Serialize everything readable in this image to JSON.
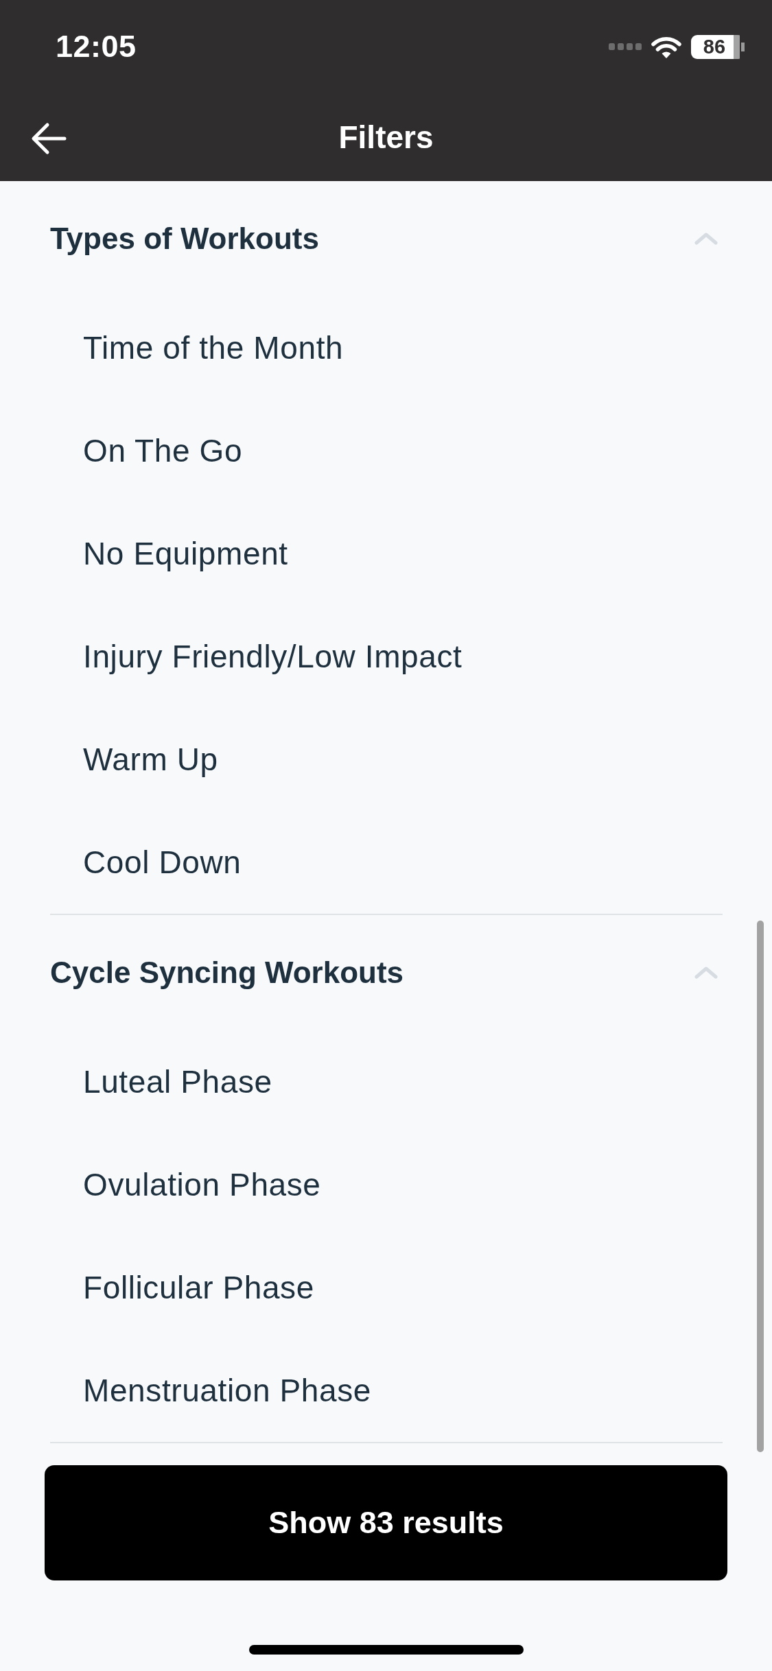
{
  "status_bar": {
    "time": "12:05",
    "battery": "86"
  },
  "header": {
    "title": "Filters"
  },
  "sections": [
    {
      "title": "Types of Workouts",
      "expanded": true,
      "items": [
        "Time of the Month",
        "On The Go",
        "No Equipment",
        "Injury Friendly/Low Impact",
        "Warm Up",
        "Cool Down"
      ]
    },
    {
      "title": "Cycle Syncing Workouts",
      "expanded": true,
      "items": [
        "Luteal Phase",
        "Ovulation Phase",
        "Follicular Phase",
        "Menstruation Phase"
      ]
    }
  ],
  "button": {
    "label": "Show 83 results"
  }
}
